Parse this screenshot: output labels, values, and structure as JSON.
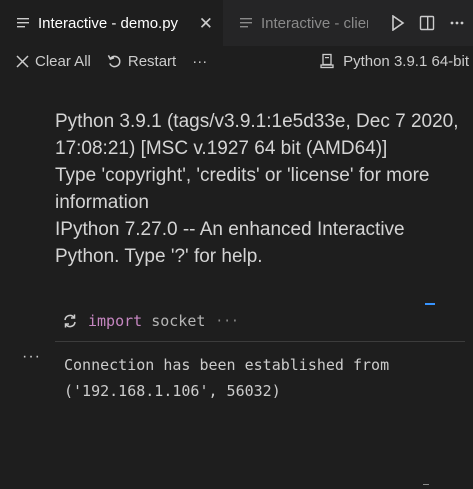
{
  "tabs": [
    {
      "label": "Interactive - demo.py",
      "active": true,
      "close_glyph": "✕"
    },
    {
      "label": "Interactive - clier",
      "active": false
    }
  ],
  "toolbar": {
    "clear_all_label": "Clear All",
    "restart_label": "Restart",
    "more_glyph": "···",
    "kernel_label": "Python 3.9.1 64-bit"
  },
  "banner": {
    "lines": [
      "Python 3.9.1 (tags/v3.9.1:1e5d33e, Dec 7 2020,",
      "17:08:21) [MSC v.1927 64 bit (AMD64)]",
      "Type 'copyright', 'credits' or 'license' for more",
      "information",
      "IPython 7.27.0 -- An enhanced Interactive",
      "Python. Type '?' for help."
    ]
  },
  "cell": {
    "keyword": "import",
    "module": "socket",
    "collapsed_glyph": "···",
    "more_glyph": "···",
    "output_lines": [
      "Connection has been established from",
      "('192.168.1.106', 56032)"
    ]
  },
  "colors": {
    "background": "#1e1e1e",
    "tabbar": "#252526",
    "keyword": "#c586c0",
    "accent": "#3794ff"
  }
}
